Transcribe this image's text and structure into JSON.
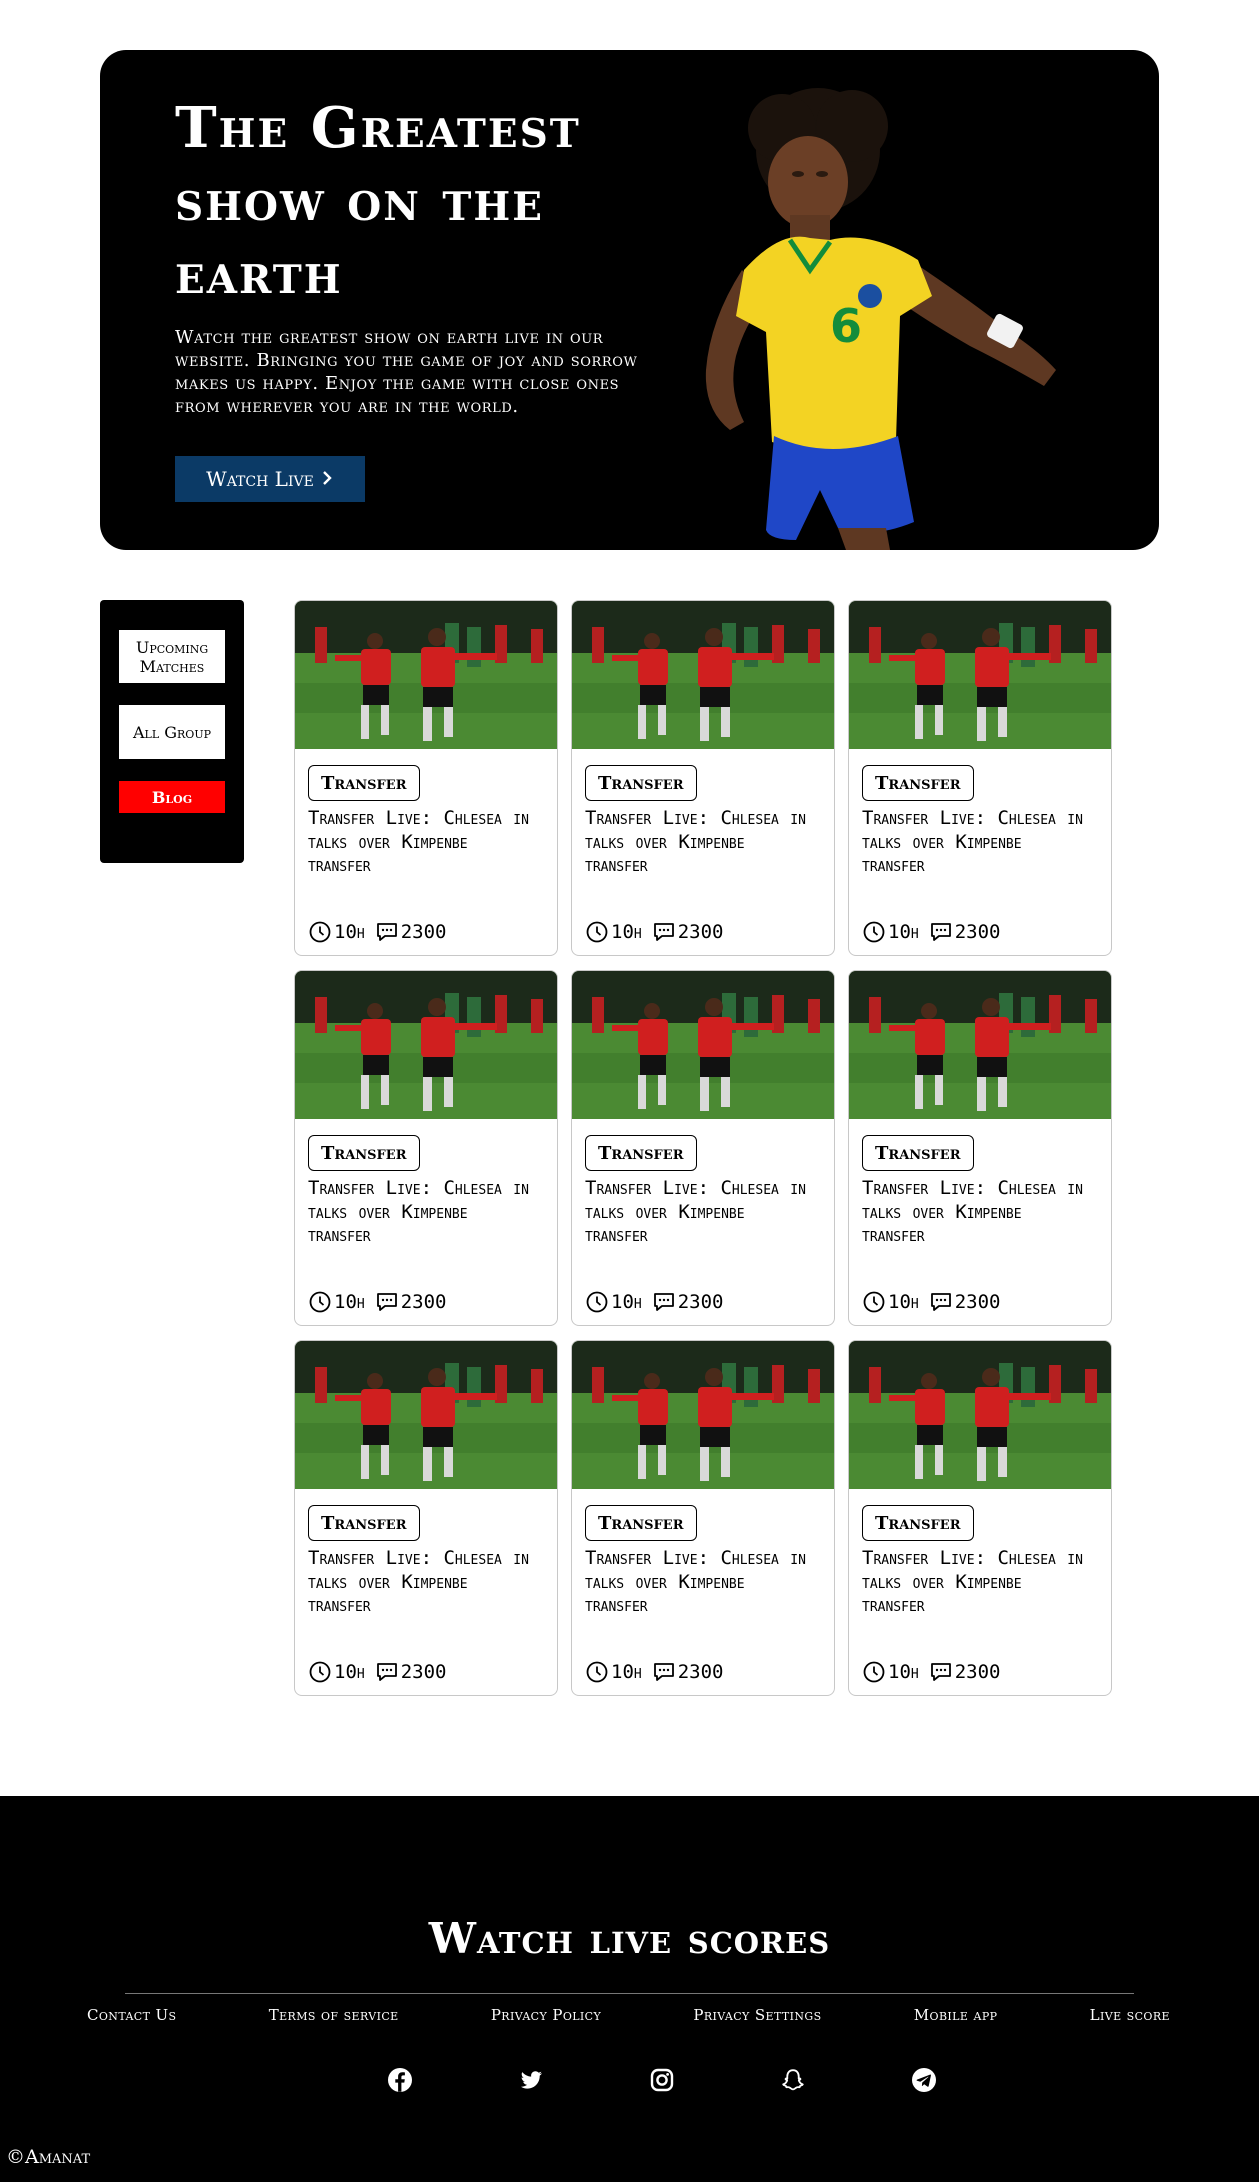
{
  "hero": {
    "title": "The Greatest show on the earth",
    "description": "Watch the greatest show on earth live in our website. Bringing you the game of joy and sorrow makes us happy. Enjoy the game with close ones from wherever you are in the world.",
    "button_label": "Watch Live",
    "button_icon": "chevron-right-icon",
    "colors": {
      "background": "#000000",
      "button": "#0b3a66"
    }
  },
  "sidebar": {
    "items": [
      {
        "label": "Upcoming Matches",
        "active": false
      },
      {
        "label": "All Group",
        "active": false
      },
      {
        "label": "Blog",
        "active": true
      }
    ],
    "active_color": "#ff0000"
  },
  "cards": [
    {
      "tag": "Transfer",
      "title": "Transfer Live: Chlesea in talks over Kimpenbe transfer",
      "time": "10h",
      "comments": "2300"
    },
    {
      "tag": "Transfer",
      "title": "Transfer Live: Chlesea in talks over Kimpenbe transfer",
      "time": "10h",
      "comments": "2300"
    },
    {
      "tag": "Transfer",
      "title": "Transfer Live: Chlesea in talks over Kimpenbe transfer",
      "time": "10h",
      "comments": "2300"
    },
    {
      "tag": "Transfer",
      "title": "Transfer Live: Chlesea in talks over Kimpenbe transfer",
      "time": "10h",
      "comments": "2300"
    },
    {
      "tag": "Transfer",
      "title": "Transfer Live: Chlesea in talks over Kimpenbe transfer",
      "time": "10h",
      "comments": "2300"
    },
    {
      "tag": "Transfer",
      "title": "Transfer Live: Chlesea in talks over Kimpenbe transfer",
      "time": "10h",
      "comments": "2300"
    },
    {
      "tag": "Transfer",
      "title": "Transfer Live: Chlesea in talks over Kimpenbe transfer",
      "time": "10h",
      "comments": "2300"
    },
    {
      "tag": "Transfer",
      "title": "Transfer Live: Chlesea in talks over Kimpenbe transfer",
      "time": "10h",
      "comments": "2300"
    },
    {
      "tag": "Transfer",
      "title": "Transfer Live: Chlesea in talks over Kimpenbe transfer",
      "time": "10h",
      "comments": "2300"
    }
  ],
  "footer": {
    "title": "Watch live scores",
    "links": [
      "Contact Us",
      "Terms of service",
      "Privacy Policy",
      "Privacy Settings",
      "Mobile app",
      "Live score"
    ],
    "socials": [
      "facebook-icon",
      "twitter-icon",
      "instagram-icon",
      "snapchat-icon",
      "telegram-icon"
    ],
    "copyright": "©Amanat"
  }
}
